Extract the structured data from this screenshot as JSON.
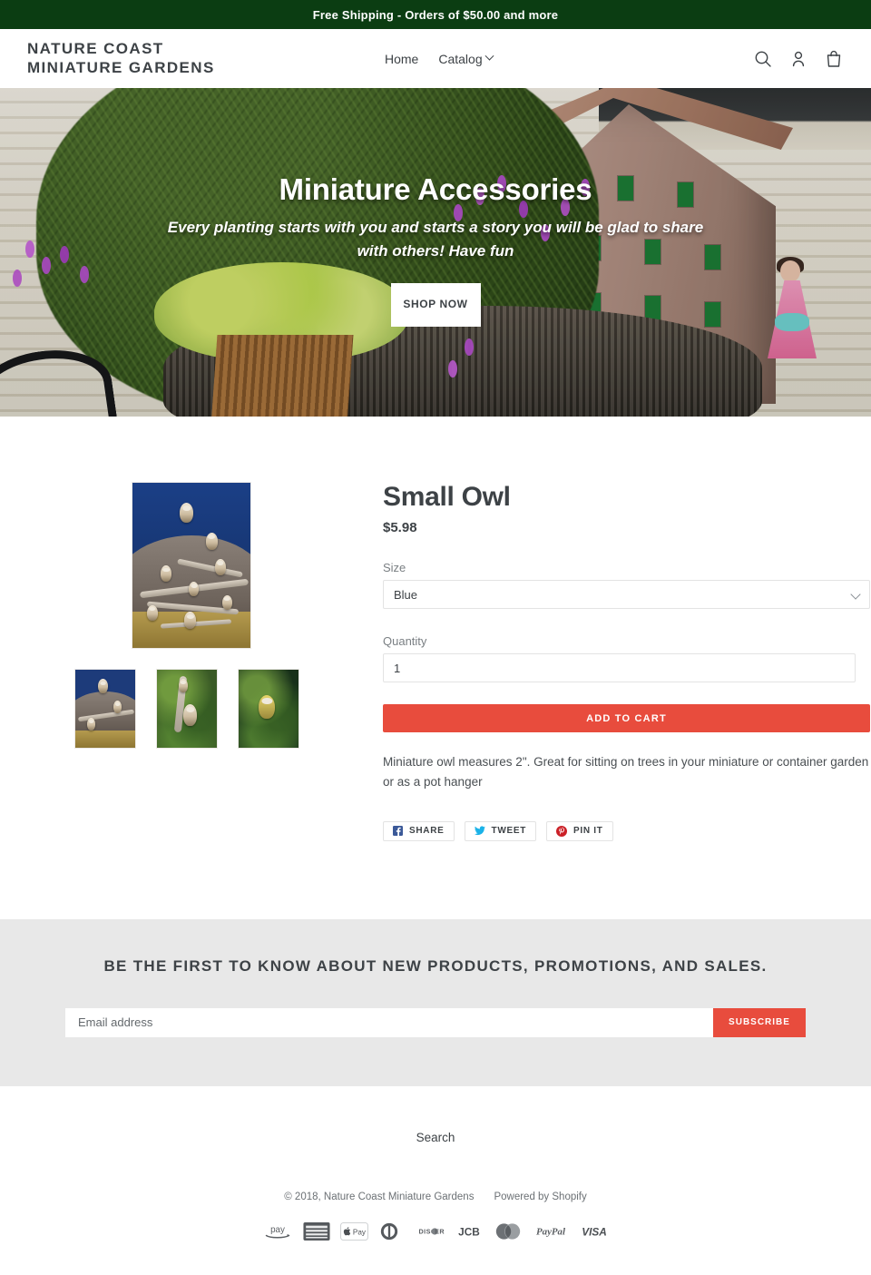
{
  "announcement": {
    "text": "Free Shipping - Orders of $50.00 and more"
  },
  "header": {
    "logo": "Nature Coast\nMiniature Gardens",
    "nav": [
      {
        "label": "Home",
        "has_caret": false
      },
      {
        "label": "Catalog",
        "has_caret": true
      }
    ],
    "icons": [
      {
        "name": "search-icon"
      },
      {
        "name": "account-icon"
      },
      {
        "name": "cart-icon"
      }
    ]
  },
  "hero": {
    "title": "Miniature Accessories",
    "subtitle": "Every planting starts with you and starts a story you will be glad to share with others! Have fun",
    "button": "SHOP\nNOW"
  },
  "product": {
    "title": "Small Owl",
    "price": "$5.98",
    "size_label": "Size",
    "size_value": "Blue",
    "size_options": [
      "Blue"
    ],
    "quantity_label": "Quantity",
    "quantity_value": "1",
    "add_to_cart": "ADD TO CART",
    "description": "Miniature owl measures 2\".  Great for sitting on trees in your miniature or container garden or as a pot hanger",
    "share": [
      {
        "label": "SHARE",
        "icon": "facebook-icon",
        "color": "#3b5998"
      },
      {
        "label": "TWEET",
        "icon": "twitter-icon",
        "color": "#1ab2e8"
      },
      {
        "label": "PIN IT",
        "icon": "pinterest-icon",
        "color": "#cb2027"
      }
    ]
  },
  "newsletter": {
    "title": "BE THE FIRST TO KNOW ABOUT NEW PRODUCTS, PROMOTIONS, AND SALES.",
    "placeholder": "Email address",
    "button": "SUBSCRIBE"
  },
  "footer": {
    "link": "Search",
    "copyright": "© 2018, Nature Coast Miniature Gardens",
    "powered_by": "Powered by Shopify",
    "payment_icons": [
      {
        "name": "amazon-pay-icon",
        "label": "pay"
      },
      {
        "name": "american-express-icon",
        "label": "AMERICAN EXPRESS"
      },
      {
        "name": "apple-pay-icon",
        "label": "Pay"
      },
      {
        "name": "diners-club-icon",
        "label": "Diners Club"
      },
      {
        "name": "discover-icon",
        "label": "DISCOVER"
      },
      {
        "name": "jcb-icon",
        "label": "JCB"
      },
      {
        "name": "master-icon",
        "label": "Mastercard"
      },
      {
        "name": "paypal-icon",
        "label": "PayPal"
      },
      {
        "name": "visa-icon",
        "label": "VISA"
      }
    ]
  },
  "colors": {
    "announcement_bg": "#0b3d12",
    "accent": "#e84c3d",
    "text": "#3d4246",
    "newsletter_bg": "#e8e8e8"
  }
}
